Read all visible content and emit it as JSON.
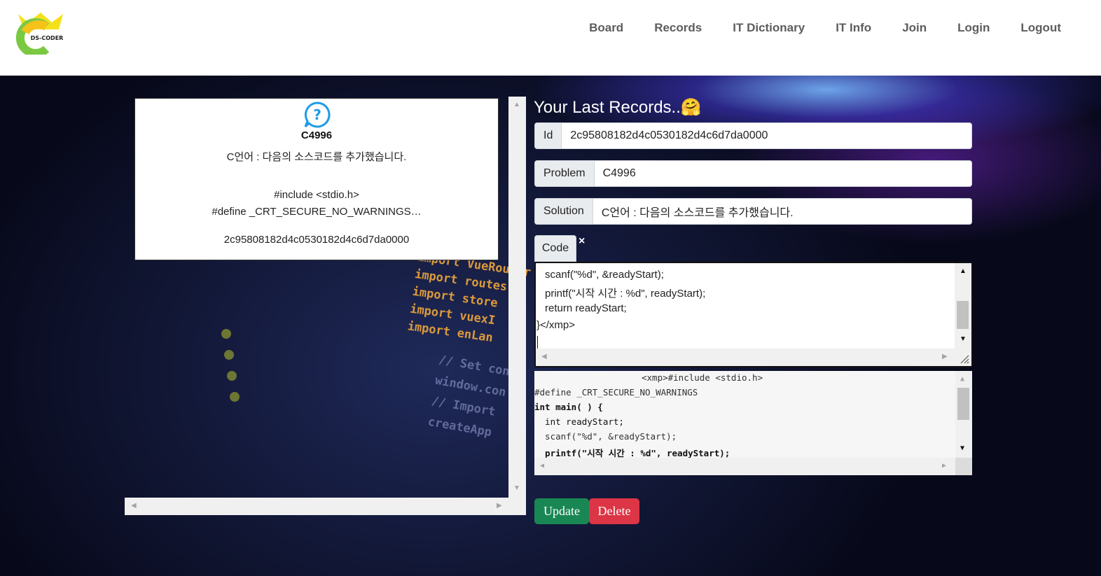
{
  "header": {
    "logo_text": "DS-CODER",
    "nav": [
      "Board",
      "Records",
      "IT Dictionary",
      "IT Info",
      "Join",
      "Login",
      "Logout"
    ]
  },
  "background_code": {
    "lines": [
      "import VueRouter",
      "import routes",
      "import store",
      "import vuexI",
      "import enLan"
    ],
    "comments": [
      "// Set cont",
      "window.con",
      "// Import",
      "createApp"
    ]
  },
  "record_card": {
    "title": "C4996",
    "description": "C언어 : 다음의 소스코드를 추가했습니다.",
    "code_line1": "#include <stdio.h>",
    "code_line2": "#define _CRT_SECURE_NO_WARNINGS…",
    "id": "2c95808182d4c0530182d4c6d7da0000"
  },
  "form": {
    "title": "Your Last Records..",
    "title_emoji": "🤗",
    "id_label": "Id",
    "id_value": "2c95808182d4c0530182d4c6d7da0000",
    "problem_label": "Problem",
    "problem_value": "C4996",
    "solution_label": "Solution",
    "solution_value": "C언어 : 다음의 소스코드를 추가했습니다.",
    "code_label": "Code",
    "code_close": "×",
    "code_lines": [
      "scanf(\"%d\", &readyStart);",
      "printf(\"시작 시간 : %d\", readyStart);",
      "return readyStart;",
      "}</xmp>"
    ],
    "preview_lines": [
      "<xmp>#include <stdio.h>",
      "#define _CRT_SECURE_NO_WARNINGS",
      "int main( ) {",
      "  int readyStart;",
      "  scanf(\"%d\", &readyStart);",
      "  printf(\"시작 시간 : %d\", readyStart);"
    ],
    "update_label": "Update",
    "delete_label": "Delete"
  },
  "colors": {
    "update": "#198754",
    "delete": "#dc3545",
    "nav_text": "#5d5d5d"
  }
}
